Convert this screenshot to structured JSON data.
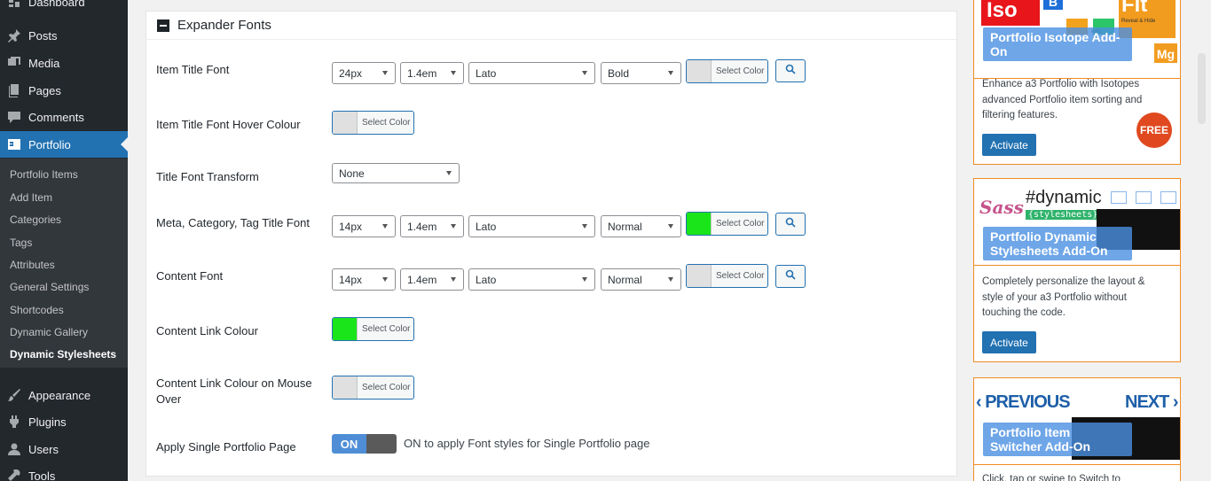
{
  "sidebar": {
    "top_items": [
      {
        "label": "Dashboard",
        "icon": "dashboard-icon"
      },
      {
        "label": "Posts",
        "icon": "pin-icon"
      },
      {
        "label": "Media",
        "icon": "media-icon"
      },
      {
        "label": "Pages",
        "icon": "pages-icon"
      },
      {
        "label": "Comments",
        "icon": "comment-icon"
      },
      {
        "label": "Portfolio",
        "icon": "a3-portfolio-icon"
      }
    ],
    "submenu": [
      "Portfolio Items",
      "Add Item",
      "Categories",
      "Tags",
      "Attributes",
      "General Settings",
      "Shortcodes",
      "Dynamic Gallery",
      "Dynamic Stylesheets"
    ],
    "bottom_items": [
      {
        "label": "Appearance",
        "icon": "brush-icon"
      },
      {
        "label": "Plugins",
        "icon": "plugin-icon"
      },
      {
        "label": "Users",
        "icon": "user-icon"
      },
      {
        "label": "Tools",
        "icon": "wrench-icon"
      }
    ]
  },
  "panel": {
    "title": "Expander Fonts",
    "select_color_label": "Select Color",
    "rows": {
      "item_title_font": {
        "label": "Item Title Font",
        "size": "24px",
        "line_height": "1.4em",
        "face": "Lato",
        "style": "Bold",
        "color": "#e0e0e0"
      },
      "hover_colour": {
        "label": "Item Title Font Hover Colour",
        "color": "#e0e0e0"
      },
      "transform": {
        "label": "Title Font Transform",
        "value": "None"
      },
      "meta_font": {
        "label": "Meta, Category, Tag Title Font",
        "size": "14px",
        "line_height": "1.4em",
        "face": "Lato",
        "style": "Normal",
        "color": "#1ae51a"
      },
      "content_font": {
        "label": "Content Font",
        "size": "14px",
        "line_height": "1.4em",
        "face": "Lato",
        "style": "Normal",
        "color": "#e0e0e0"
      },
      "content_link_colour": {
        "label": "Content Link Colour",
        "color": "#1ae51a"
      },
      "content_link_hover": {
        "label_line1": "Content Link Colour on Mouse",
        "label_line2": "Over",
        "color": "#e0e0e0"
      },
      "apply_single": {
        "label": "Apply Single Portfolio Page",
        "toggle": "ON",
        "desc": "ON to apply Font styles for Single Portfolio page"
      }
    }
  },
  "addons": [
    {
      "title": "Portfolio Isotope Add-On",
      "image_texts": [
        "Iso",
        "B",
        "Flt",
        "Mg",
        "Reveal & Hide",
        "ems"
      ],
      "desc_lines": [
        "Enhance a3 Portfolio with Isotopes",
        "advanced Portfolio item sorting and",
        "filtering features."
      ],
      "button": "Activate",
      "badge": "FREE"
    },
    {
      "title": "Portfolio Dynamic Stylesheets Add-On",
      "image_texts": [
        "#dynamic",
        "{stylesheets}",
        "Sass"
      ],
      "desc_lines": [
        "Completely personalize the layout &",
        "style of your a3 Portfolio without",
        "touching the code."
      ],
      "button": "Activate"
    },
    {
      "title": "Portfolio Item Switcher Add-On",
      "image_texts": [
        "PREVIOUS",
        "NEXT"
      ],
      "desc_lines": [
        "Click, tap or swipe to Switch to"
      ]
    }
  ]
}
